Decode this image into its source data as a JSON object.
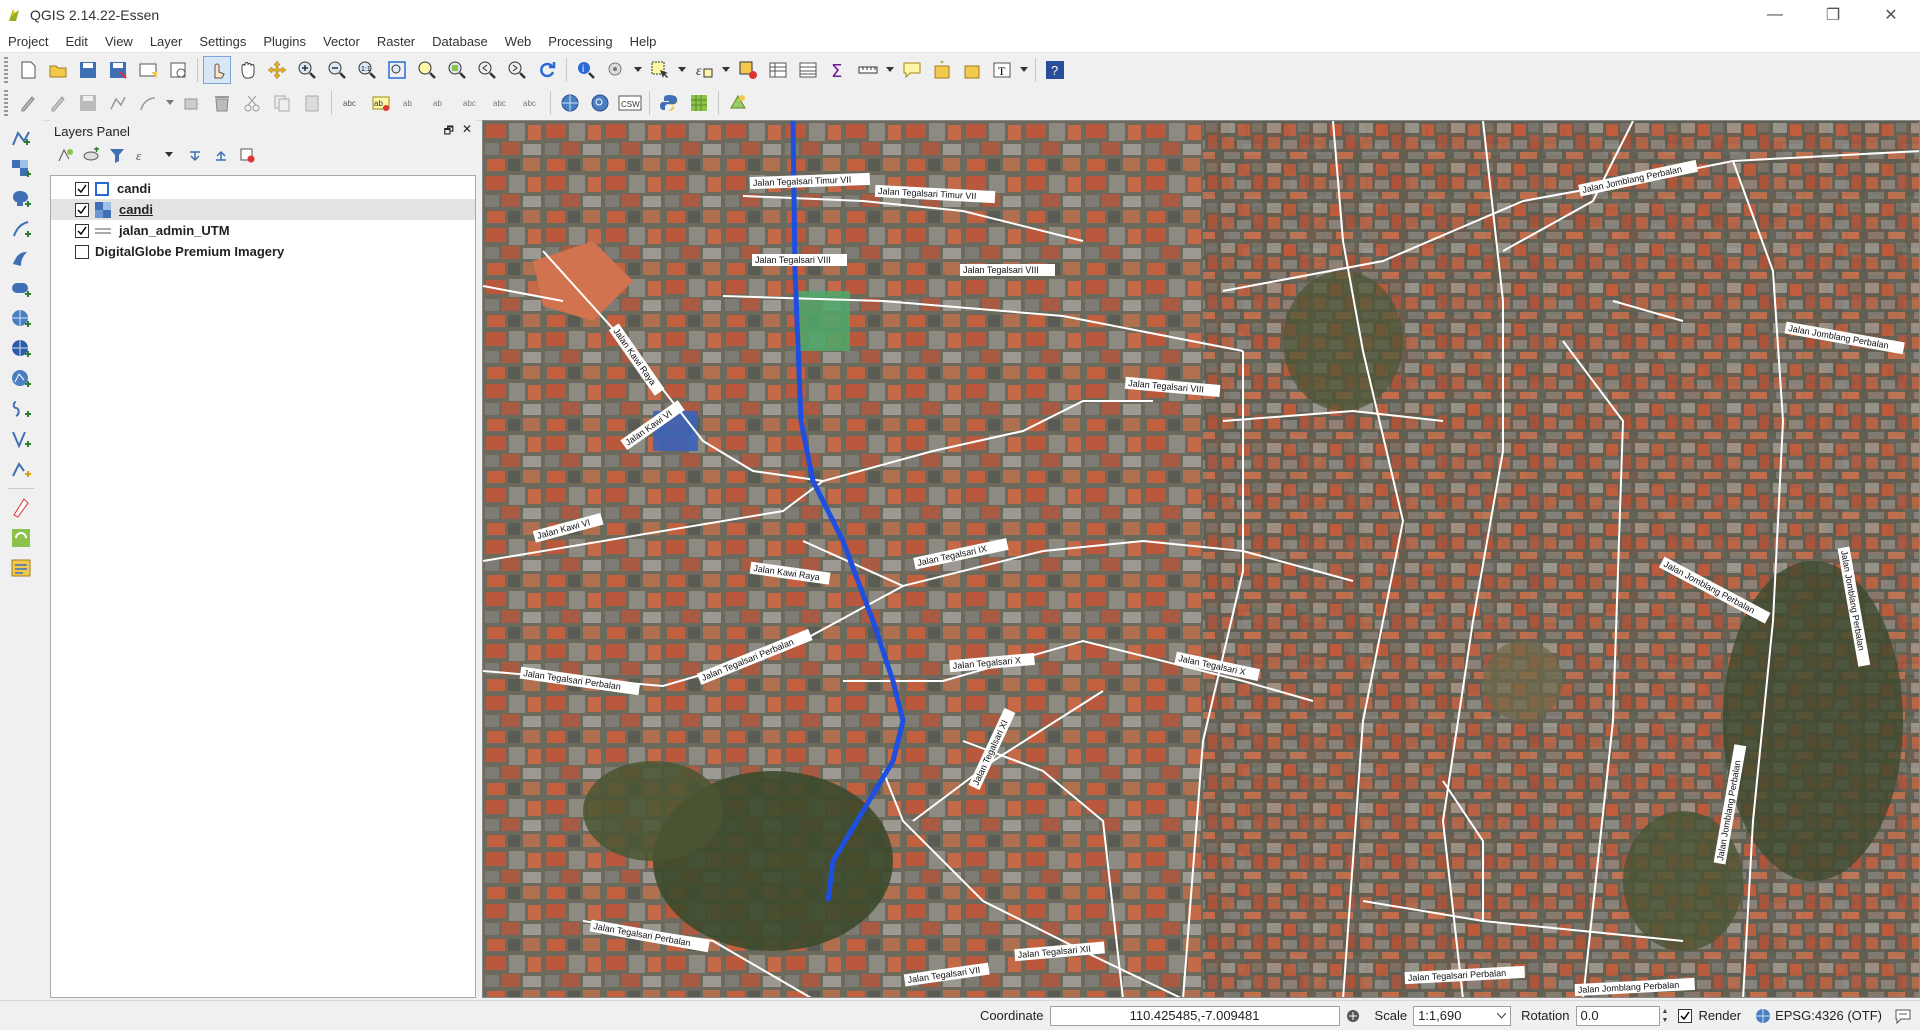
{
  "window": {
    "title": "QGIS 2.14.22-Essen",
    "minimize": "—",
    "restore": "❐",
    "close": "✕"
  },
  "menu": [
    "Project",
    "Edit",
    "View",
    "Layer",
    "Settings",
    "Plugins",
    "Vector",
    "Raster",
    "Database",
    "Web",
    "Processing",
    "Help"
  ],
  "layers_panel": {
    "title": "Layers Panel",
    "float": "🗗",
    "close": "✕",
    "layers": [
      {
        "name": "candi",
        "checked": true,
        "icon": "polygon-layer-icon",
        "selected": false
      },
      {
        "name": "candi",
        "checked": true,
        "icon": "raster-layer-icon",
        "selected": true
      },
      {
        "name": "jalan_admin_UTM",
        "checked": true,
        "icon": "line-layer-icon",
        "selected": false
      },
      {
        "name": "DigitalGlobe Premium Imagery",
        "checked": false,
        "icon": "",
        "selected": false
      }
    ]
  },
  "map": {
    "road_labels": [
      "Jalan Tegalsari Timur VII",
      "Jalan Tegalsari Timur VII",
      "Jalan Tegalsari VIII",
      "Jalan Tegalsari VIII",
      "Jalan Tegalsari VIII",
      "Jalan Kawi Raya",
      "Jalan Kawi VI",
      "Jalan Kawi VI",
      "Jalan Kawi Raya",
      "Jalan Tegalsari IX",
      "Jalan Tegalsari X",
      "Jalan Tegalsari X",
      "Jalan Tegalsari Perbalan",
      "Jalan Tegalsari Perbalan",
      "Jalan Tegalsari XI",
      "Jalan Tegalsari XII",
      "Jalan Tegalsari VII",
      "Jalan Jomblang Perbalan",
      "Jalan Jomblang Perbalan",
      "Jalan Jomblang Perbalan",
      "Jalan Jomblang Perbalan",
      "Jalan Jomblang Perbalan",
      "Jalan Tegalsari Perbalan",
      "Jalan Tegalsari Perbalan",
      "Jalan Jomblang Perbalan"
    ]
  },
  "status": {
    "coordinate_label": "Coordinate",
    "coordinate_value": "110.425485,-7.009481",
    "scale_label": "Scale",
    "scale_value": "1:1,690",
    "rotation_label": "Rotation",
    "rotation_value": "0.0",
    "render_label": "Render",
    "render_checked": true,
    "crs": "EPSG:4326 (OTF)"
  },
  "colors": {
    "selection_route": "#1f4fe0",
    "accent_blue": "#2a6ad8"
  }
}
